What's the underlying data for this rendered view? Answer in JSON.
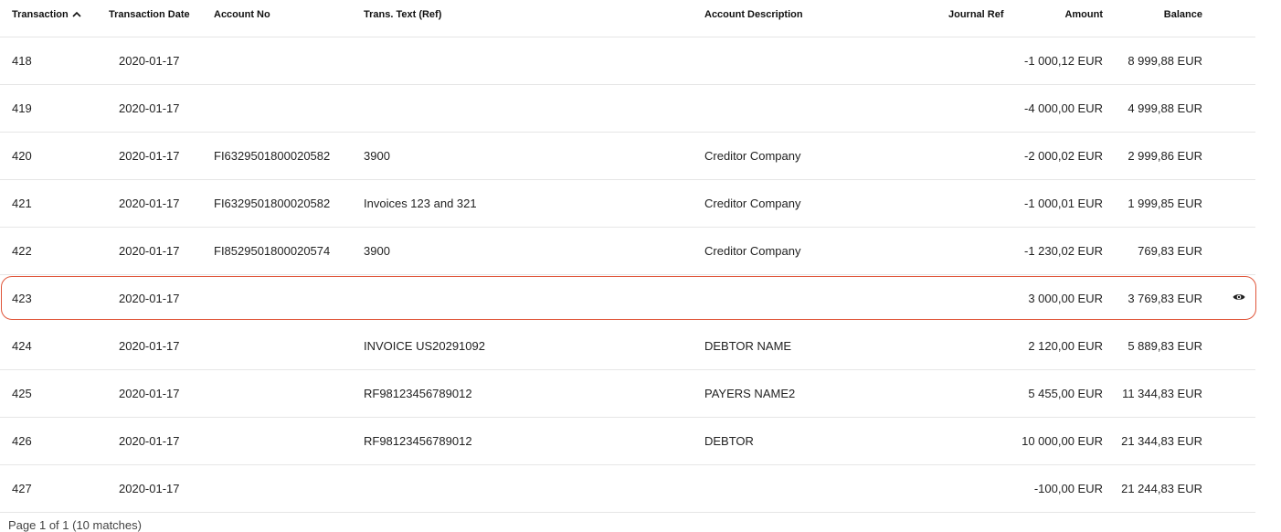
{
  "table": {
    "headers": {
      "transaction": "Transaction",
      "date": "Transaction Date",
      "account": "Account No",
      "text": "Trans. Text (Ref)",
      "description": "Account Description",
      "journal": "Journal Ref",
      "amount": "Amount",
      "balance": "Balance"
    },
    "sort_icon": "chevron-up-icon",
    "rows": [
      {
        "id": "418",
        "date": "2020-01-17",
        "account": "",
        "text": "",
        "description": "",
        "journal": "",
        "amount": "-1 000,12 EUR",
        "balance": "8 999,88 EUR"
      },
      {
        "id": "419",
        "date": "2020-01-17",
        "account": "",
        "text": "",
        "description": "",
        "journal": "",
        "amount": "-4 000,00 EUR",
        "balance": "4 999,88 EUR"
      },
      {
        "id": "420",
        "date": "2020-01-17",
        "account": "FI6329501800020582",
        "text": "3900",
        "description": "Creditor Company",
        "journal": "",
        "amount": "-2 000,02 EUR",
        "balance": "2 999,86 EUR"
      },
      {
        "id": "421",
        "date": "2020-01-17",
        "account": "FI6329501800020582",
        "text": "Invoices 123 and 321",
        "description": "Creditor Company",
        "journal": "",
        "amount": "-1 000,01 EUR",
        "balance": "1 999,85 EUR"
      },
      {
        "id": "422",
        "date": "2020-01-17",
        "account": "FI8529501800020574",
        "text": "3900",
        "description": "Creditor Company",
        "journal": "",
        "amount": "-1 230,02 EUR",
        "balance": "769,83 EUR"
      },
      {
        "id": "423",
        "date": "2020-01-17",
        "account": "",
        "text": "",
        "description": "",
        "journal": "",
        "amount": "3 000,00 EUR",
        "balance": "3 769,83 EUR"
      },
      {
        "id": "424",
        "date": "2020-01-17",
        "account": "",
        "text": "INVOICE US20291092",
        "description": "DEBTOR NAME",
        "journal": "",
        "amount": "2 120,00 EUR",
        "balance": "5 889,83 EUR"
      },
      {
        "id": "425",
        "date": "2020-01-17",
        "account": "",
        "text": "RF98123456789012",
        "description": "PAYERS NAME2",
        "journal": "",
        "amount": "5 455,00 EUR",
        "balance": "11 344,83 EUR"
      },
      {
        "id": "426",
        "date": "2020-01-17",
        "account": "",
        "text": "RF98123456789012",
        "description": "DEBTOR",
        "journal": "",
        "amount": "10 000,00 EUR",
        "balance": "21 344,83 EUR"
      },
      {
        "id": "427",
        "date": "2020-01-17",
        "account": "",
        "text": "",
        "description": "",
        "journal": "",
        "amount": "-100,00 EUR",
        "balance": "21 244,83 EUR"
      }
    ],
    "selected_row": 5,
    "row_action_icon": "eye-icon"
  },
  "footer": {
    "pagination": "Page 1 of 1 (10 matches)"
  },
  "colors": {
    "selection_border": "#e0563a",
    "divider": "#e6e6e6"
  }
}
